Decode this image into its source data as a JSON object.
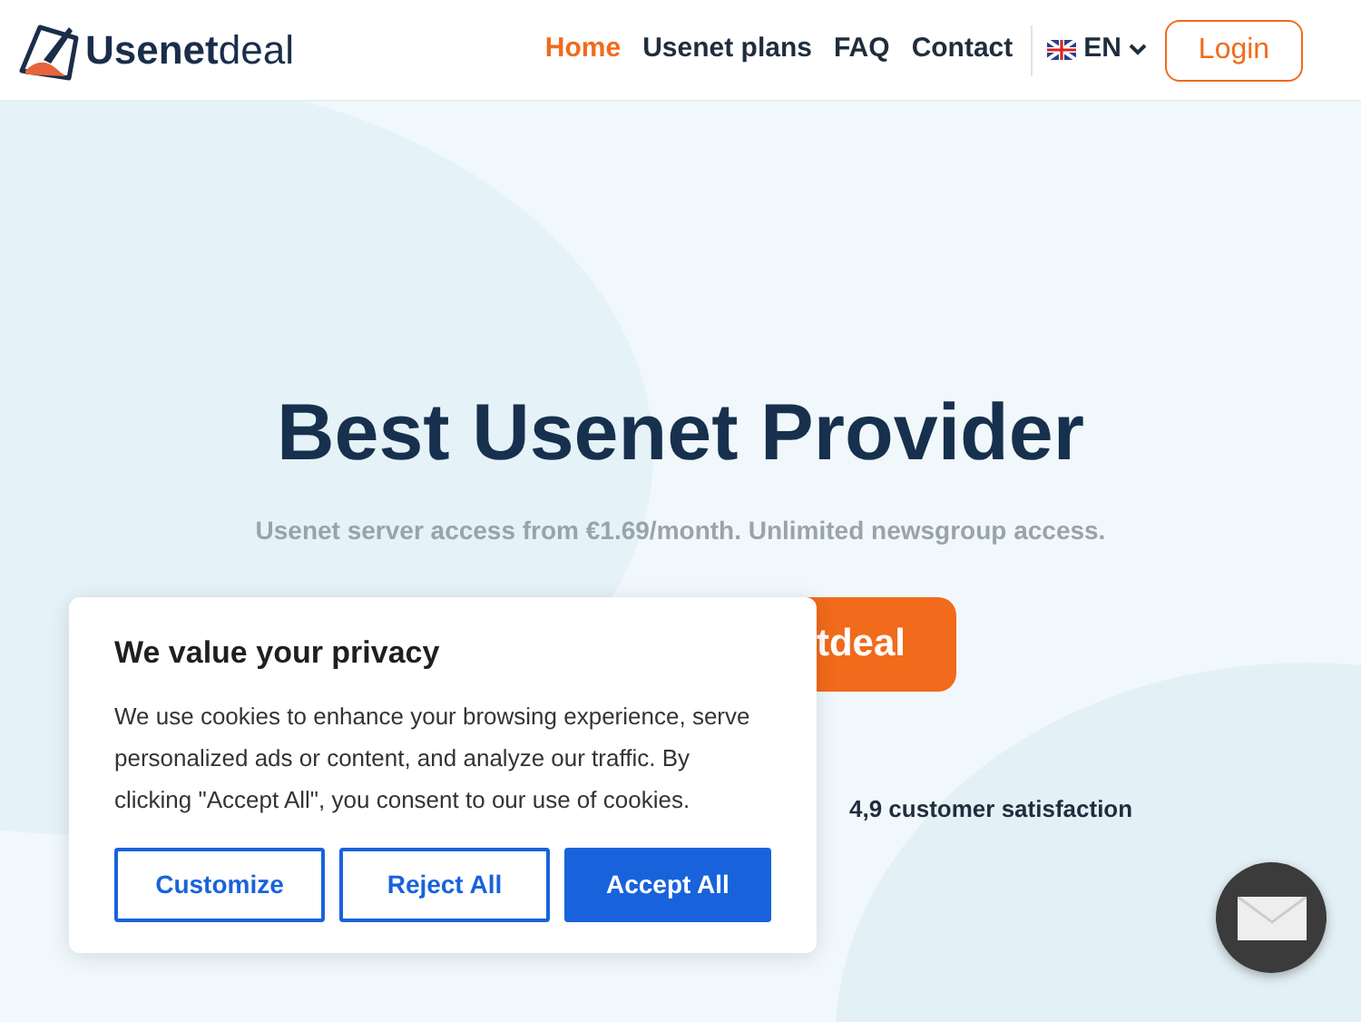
{
  "header": {
    "logo": "**Usenet**deal",
    "nav": [
      {
        "label": "Home",
        "selected": true
      },
      {
        "label": "Usenet plans",
        "selected": false
      },
      {
        "label": "FAQ",
        "selected": false
      },
      {
        "label": "Contact",
        "selected": false
      }
    ],
    "language": "EN",
    "login": "Login"
  },
  "hero": {
    "title": "Best Usenet Provider",
    "subtitle": "Usenet server access from €1.69/month. Unlimited newsgroup access.",
    "cta": "tdeal",
    "rating": "4,9 customer satisfaction"
  },
  "cookie_banner": {
    "title": "We value your privacy",
    "text": "We use cookies to enhance your browsing experience, serve personalized ads or content, and analyze our traffic. By clicking \"Accept All\", you consent to our use of cookies.",
    "buttons": [
      {
        "label": "Customize",
        "kind": "outline"
      },
      {
        "label": "Reject All",
        "kind": "outline"
      },
      {
        "label": "Accept All",
        "kind": "primary"
      }
    ]
  }
}
